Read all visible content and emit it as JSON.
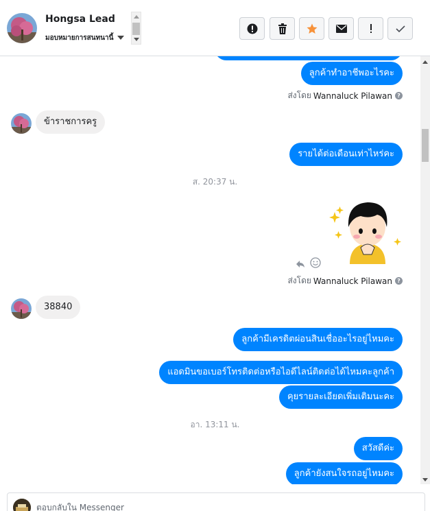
{
  "header": {
    "contact_name": "Hongsa Lead",
    "assign_label": "มอบหมายการสนทนานี้",
    "actions": [
      {
        "name": "mark-spam-button",
        "icon": "alert-circle-icon"
      },
      {
        "name": "delete-button",
        "icon": "trash-icon"
      },
      {
        "name": "star-button",
        "icon": "star-icon"
      },
      {
        "name": "mark-unread-button",
        "icon": "envelope-icon"
      },
      {
        "name": "follow-up-button",
        "icon": "exclamation-icon"
      },
      {
        "name": "mark-done-button",
        "icon": "checkmark-icon"
      }
    ]
  },
  "conversation": {
    "messages": [
      {
        "direction": "out",
        "text": ""
      },
      {
        "direction": "out",
        "text": "ลูกค้าทำอาชีพอะไรคะ"
      },
      {
        "direction": "meta",
        "sent_by_prefix": "ส่งโดย",
        "sender": "Wannaluck Pilawan"
      },
      {
        "direction": "in",
        "text": "ข้าราชการครู"
      },
      {
        "direction": "out",
        "text": "รายได้ต่อเดือนเท่าไหร่คะ"
      },
      {
        "direction": "timestamp",
        "text": "ส. 20:37 น."
      },
      {
        "direction": "sticker",
        "icon": "girl-sticker"
      },
      {
        "direction": "meta",
        "sent_by_prefix": "ส่งโดย",
        "sender": "Wannaluck Pilawan"
      },
      {
        "direction": "in",
        "text": "38840"
      },
      {
        "direction": "out",
        "text": "ลูกค้ามีเครดิตผ่อนสินเชื่ออะไรอยู่ไหมคะ"
      },
      {
        "direction": "out",
        "text": "แอดมินขอเบอร์โทรติดต่อหรือไอดีไลน์ติดต่อได้ไหมคะลูกค้า"
      },
      {
        "direction": "out",
        "text": "คุยรายละเอียดเพิ่มเติมนะคะ"
      },
      {
        "direction": "timestamp",
        "text": "อา. 13:11 น."
      },
      {
        "direction": "out",
        "text": "สวัสดีค่ะ"
      },
      {
        "direction": "out",
        "text": "ลูกค้ายังสนใจรถอยู่ไหมคะ"
      }
    ],
    "sent_by": {
      "prefix": "ส่งโดย",
      "sender": "Wannaluck Pilawan"
    },
    "help_mark": "?"
  },
  "composer": {
    "placeholder": "ตอบกลับใน Messenger"
  },
  "colors": {
    "outgoing_bubble": "#0084ff",
    "incoming_bubble": "#f1f0f0",
    "star_accent": "#f7923a"
  }
}
